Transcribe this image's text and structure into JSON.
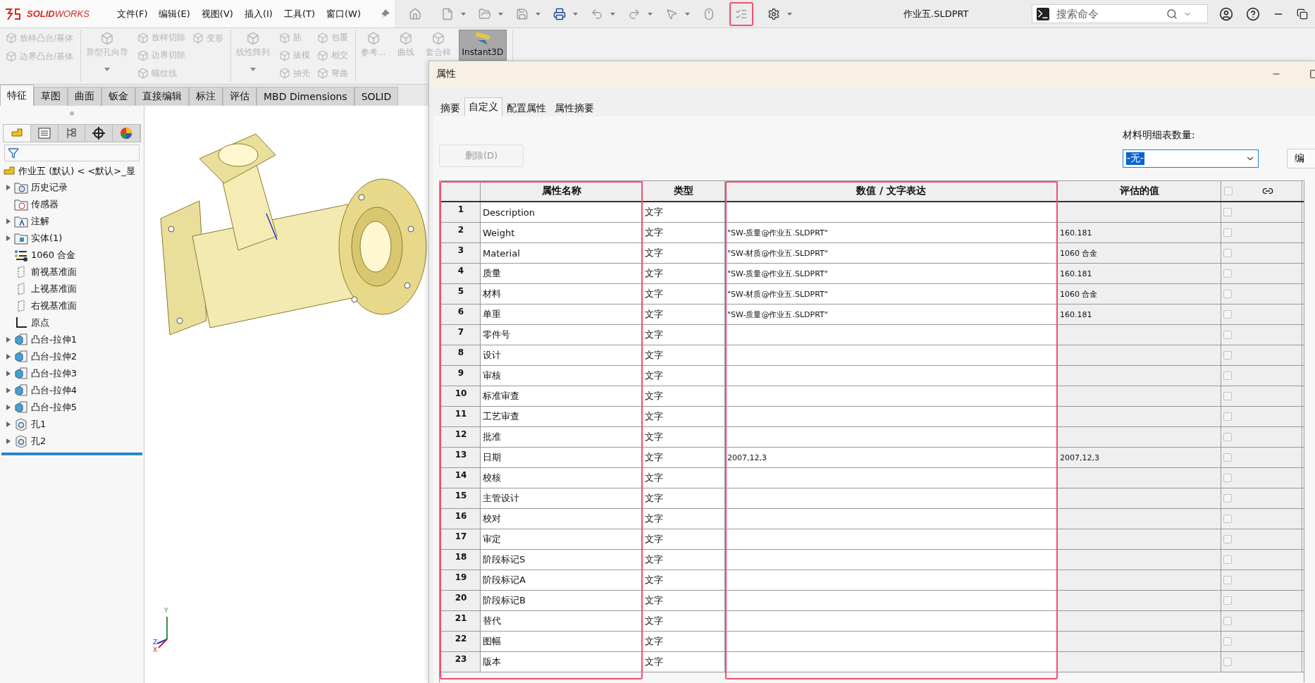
{
  "logo": "**SOLID**WORKS",
  "menu": [
    "文件(F)",
    "编辑(E)",
    "视图(V)",
    "插入(I)",
    "工具(T)",
    "窗口(W)"
  ],
  "quick_toolbar": [
    {
      "kind": "home",
      "dropdown": false,
      "highlighted": false
    },
    {
      "kind": "new",
      "dropdown": true,
      "highlighted": false
    },
    {
      "kind": "open",
      "dropdown": true,
      "highlighted": false
    },
    {
      "kind": "save",
      "dropdown": true,
      "highlighted": false
    },
    {
      "kind": "print",
      "dropdown": true,
      "highlighted": false
    },
    {
      "kind": "undo",
      "dropdown": true,
      "highlighted": false
    },
    {
      "kind": "redo",
      "dropdown": true,
      "highlighted": false
    },
    {
      "kind": "select",
      "dropdown": true,
      "highlighted": false
    },
    {
      "kind": "mouse",
      "dropdown": false,
      "highlighted": false
    },
    {
      "kind": "properties",
      "dropdown": false,
      "highlighted": true
    },
    {
      "kind": "options",
      "dropdown": true,
      "highlighted": false
    }
  ],
  "title": "作业五.SLDPRT",
  "search": {
    "placeholder": "搜索命令"
  },
  "ribbon": [
    {
      "columns": [
        [
          {
            "label": "放样凸台/基体",
            "kind": "small",
            "disabled": true
          },
          {
            "label": "边界凸台/基体",
            "kind": "small",
            "disabled": true
          }
        ]
      ]
    },
    {
      "columns": [
        [
          {
            "label": "异型孔向导",
            "kind": "large",
            "disabled": true,
            "pressed": false,
            "dropdown": true
          }
        ],
        [
          {
            "label": "放样切除",
            "kind": "small",
            "disabled": true
          },
          {
            "label": "边界切除",
            "kind": "small",
            "disabled": true
          },
          {
            "label": "螺纹线",
            "kind": "small",
            "disabled": true
          }
        ],
        [
          {
            "label": "变形",
            "kind": "small",
            "disabled": true
          }
        ]
      ]
    },
    {
      "columns": [
        [
          {
            "label": "线性阵列",
            "kind": "large",
            "disabled": true,
            "pressed": false,
            "dropdown": true
          }
        ],
        [
          {
            "label": "筋",
            "kind": "small",
            "disabled": true
          },
          {
            "label": "拔模",
            "kind": "small",
            "disabled": true
          },
          {
            "label": "抽壳",
            "kind": "small",
            "disabled": true
          }
        ],
        [
          {
            "label": "包覆",
            "kind": "small",
            "disabled": true
          },
          {
            "label": "相交",
            "kind": "small",
            "disabled": true
          },
          {
            "label": "弯曲",
            "kind": "small",
            "disabled": true
          }
        ]
      ]
    },
    {
      "columns": [
        [
          {
            "label": "参考...",
            "kind": "large",
            "disabled": true,
            "pressed": false,
            "dropdown": false
          }
        ],
        [
          {
            "label": "曲线",
            "kind": "large",
            "disabled": true,
            "pressed": false,
            "dropdown": false
          }
        ],
        [
          {
            "label": "套合样",
            "kind": "large",
            "disabled": true,
            "pressed": false,
            "dropdown": false
          }
        ],
        [
          {
            "label": "Instant3D",
            "kind": "large",
            "disabled": false,
            "pressed": true,
            "dropdown": false
          }
        ]
      ]
    }
  ],
  "command_tabs": [
    {
      "label": "特征",
      "selected": true
    },
    {
      "label": "草图",
      "selected": false
    },
    {
      "label": "曲面",
      "selected": false
    },
    {
      "label": "钣金",
      "selected": false
    },
    {
      "label": "直接编辑",
      "selected": false
    },
    {
      "label": "标注",
      "selected": false
    },
    {
      "label": "评估",
      "selected": false
    },
    {
      "label": "MBD Dimensions",
      "selected": false
    },
    {
      "label": "SOLID",
      "selected": false
    }
  ],
  "feature_manager": {
    "panel_tabs": [
      {
        "kind": "features",
        "selected": true
      },
      {
        "kind": "properties",
        "selected": false
      },
      {
        "kind": "configurations",
        "selected": false
      },
      {
        "kind": "dimxpert",
        "selected": false
      },
      {
        "kind": "appearance",
        "selected": false
      }
    ],
    "root": "作业五 (默认) < <默认>_显",
    "items": [
      {
        "label": "历史记录",
        "kind": "history",
        "expandable": true
      },
      {
        "label": "传感器",
        "kind": "sensor",
        "expandable": false
      },
      {
        "label": "注解",
        "kind": "annotation",
        "expandable": true
      },
      {
        "label": "实体(1)",
        "kind": "body",
        "expandable": true
      },
      {
        "label": "1060 合金",
        "kind": "material",
        "expandable": false
      },
      {
        "label": "前视基准面",
        "kind": "plane",
        "expandable": false
      },
      {
        "label": "上视基准面",
        "kind": "plane",
        "expandable": false
      },
      {
        "label": "右视基准面",
        "kind": "plane",
        "expandable": false
      },
      {
        "label": "原点",
        "kind": "origin",
        "expandable": false
      },
      {
        "label": "凸台-拉伸1",
        "kind": "extrude",
        "expandable": true
      },
      {
        "label": "凸台-拉伸2",
        "kind": "extrude",
        "expandable": true
      },
      {
        "label": "凸台-拉伸3",
        "kind": "extrude",
        "expandable": true
      },
      {
        "label": "凸台-拉伸4",
        "kind": "extrude",
        "expandable": true
      },
      {
        "label": "凸台-拉伸5",
        "kind": "extrude",
        "expandable": true
      },
      {
        "label": "孔1",
        "kind": "hole",
        "expandable": true
      },
      {
        "label": "孔2",
        "kind": "hole",
        "expandable": true
      }
    ]
  },
  "viewport": {
    "triad": [
      "Y",
      "Z",
      "X"
    ]
  },
  "dialog": {
    "title": "属性",
    "tabs": [
      {
        "label": "摘要",
        "selected": false
      },
      {
        "label": "自定义",
        "selected": true
      },
      {
        "label": "配置属性",
        "selected": false
      },
      {
        "label": "属性摘要",
        "selected": false
      }
    ],
    "delete_button": {
      "label": "删除(D)",
      "disabled": true
    },
    "bom_label": "材料明细表数量:",
    "bom_select": {
      "value": "-无-"
    },
    "edit_button": {
      "label": "编"
    },
    "table": {
      "columns": [
        {
          "label": "属性名称",
          "highlighted": true
        },
        {
          "label": "类型",
          "highlighted": false
        },
        {
          "label": "数值 / 文字表达",
          "highlighted": true
        },
        {
          "label": "评估的值",
          "highlighted": false
        }
      ],
      "header_checkbox": {
        "checked": false
      },
      "rows": [
        {
          "number": "1",
          "name": "Description",
          "type": "文字",
          "checked": false
        },
        {
          "number": "2",
          "name": "Weight",
          "type": "文字",
          "value": "\"SW-质量@作业五.SLDPRT\"",
          "evaluated": "160.181",
          "checked": false
        },
        {
          "number": "3",
          "name": "Material",
          "type": "文字",
          "value": "\"SW-材质@作业五.SLDPRT\"",
          "evaluated": "1060 合金",
          "checked": false
        },
        {
          "number": "4",
          "name": "质量",
          "type": "文字",
          "value": "\"SW-质量@作业五.SLDPRT\"",
          "evaluated": "160.181",
          "checked": false
        },
        {
          "number": "5",
          "name": "材料",
          "type": "文字",
          "value": "\"SW-材质@作业五.SLDPRT\"",
          "evaluated": "1060 合金",
          "checked": false
        },
        {
          "number": "6",
          "name": "单重",
          "type": "文字",
          "value": "\"SW-质量@作业五.SLDPRT\"",
          "evaluated": "160.181",
          "checked": false
        },
        {
          "number": "7",
          "name": "零件号",
          "type": "文字",
          "checked": false
        },
        {
          "number": "8",
          "name": "设计",
          "type": "文字",
          "checked": false
        },
        {
          "number": "9",
          "name": "审核",
          "type": "文字",
          "checked": false
        },
        {
          "number": "10",
          "name": "标准审查",
          "type": "文字",
          "checked": false
        },
        {
          "number": "11",
          "name": "工艺审查",
          "type": "文字",
          "checked": false
        },
        {
          "number": "12",
          "name": "批准",
          "type": "文字",
          "checked": false
        },
        {
          "number": "13",
          "name": "日期",
          "type": "文字",
          "value": "2007,12,3",
          "evaluated": "2007,12,3",
          "checked": false
        },
        {
          "number": "14",
          "name": "校核",
          "type": "文字",
          "checked": false
        },
        {
          "number": "15",
          "name": "主管设计",
          "type": "文字",
          "checked": false
        },
        {
          "number": "16",
          "name": "校对",
          "type": "文字",
          "checked": false
        },
        {
          "number": "17",
          "name": "审定",
          "type": "文字",
          "checked": false
        },
        {
          "number": "18",
          "name": "阶段标记S",
          "type": "文字",
          "checked": false
        },
        {
          "number": "19",
          "name": "阶段标记A",
          "type": "文字",
          "checked": false
        },
        {
          "number": "20",
          "name": "阶段标记B",
          "type": "文字",
          "checked": false
        },
        {
          "number": "21",
          "name": "替代",
          "type": "文字",
          "checked": false
        },
        {
          "number": "22",
          "name": "图幅",
          "type": "文字",
          "checked": false
        },
        {
          "number": "23",
          "name": "版本",
          "type": "文字",
          "checked": false
        }
      ]
    }
  }
}
